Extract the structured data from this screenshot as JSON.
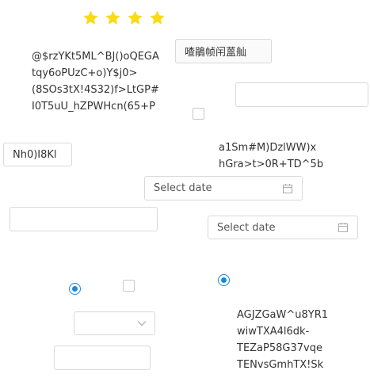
{
  "rating": {
    "value": 4,
    "max": 4,
    "color": "#fadb14"
  },
  "texts": {
    "block1": "@$rzYKt5ML^BJ()oQEGA\ntqy6oPUzC+o)Y$j0>\n(8SOs3tX!4S32)f>LtGP#\nI0T5uU_hZPWHcn(65+P",
    "block2": "a1Sm#M)DzlWW)x\nhGra>t>0R+TD^5b",
    "block3": "AGJZGaW^u8YR1\nwiwTXA4l6dk-\nTEZaP58G37vqe\nTENvsGmhTX!Sk"
  },
  "inputs": {
    "top_right_value": "喳鵑帧闬蒕舢",
    "left_value": "Nh0)I8Kl",
    "right_empty": "",
    "mid_left_empty": "",
    "bottom_empty": ""
  },
  "datepickers": {
    "first_placeholder": "Select date",
    "second_placeholder": "Select date"
  },
  "select": {
    "value": ""
  },
  "icons": {
    "star": "star-icon",
    "calendar": "calendar-icon",
    "chevron": "chevron-down-icon"
  },
  "colors": {
    "accent": "#1a87e0",
    "star": "#fadb14"
  }
}
